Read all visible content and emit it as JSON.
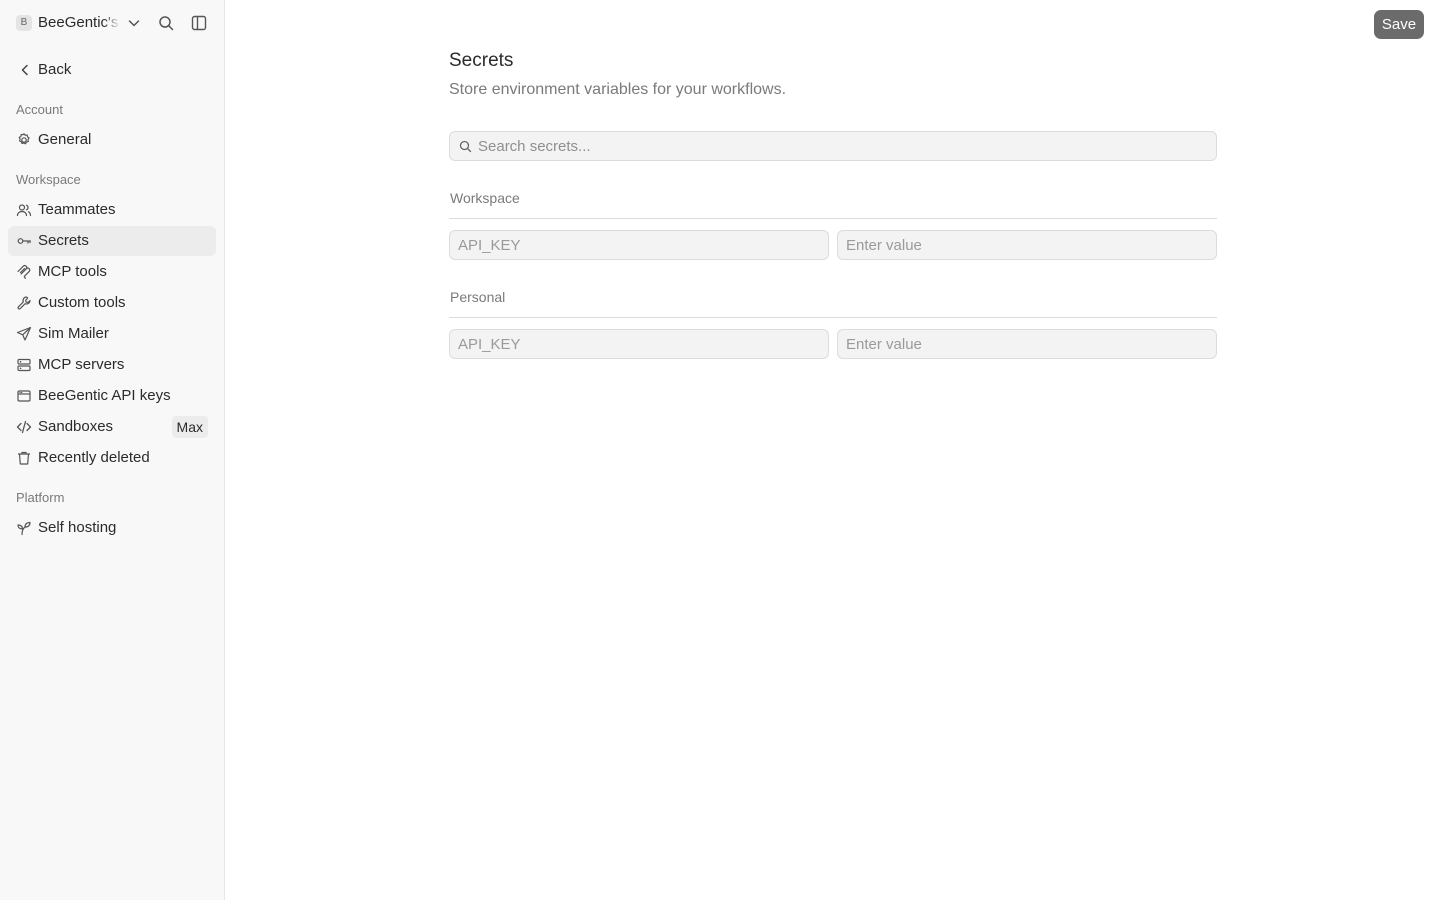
{
  "workspace": {
    "avatar_letter": "B",
    "name": "BeeGentic's"
  },
  "sidebar": {
    "back_label": "Back",
    "sections": [
      {
        "label": "Account",
        "items": [
          {
            "label": "General",
            "icon": "gear-icon",
            "active": false
          }
        ]
      },
      {
        "label": "Workspace",
        "items": [
          {
            "label": "Teammates",
            "icon": "users-icon",
            "active": false
          },
          {
            "label": "Secrets",
            "icon": "key-icon",
            "active": true
          },
          {
            "label": "MCP tools",
            "icon": "mcp-icon",
            "active": false
          },
          {
            "label": "Custom tools",
            "icon": "wrench-icon",
            "active": false
          },
          {
            "label": "Sim Mailer",
            "icon": "send-icon",
            "active": false
          },
          {
            "label": "MCP servers",
            "icon": "server-icon",
            "active": false
          },
          {
            "label": "BeeGentic API keys",
            "icon": "browser-window-icon",
            "active": false
          },
          {
            "label": "Sandboxes",
            "icon": "code-icon",
            "active": false,
            "badge": "Max"
          },
          {
            "label": "Recently deleted",
            "icon": "trash-icon",
            "active": false
          }
        ]
      },
      {
        "label": "Platform",
        "items": [
          {
            "label": "Self hosting",
            "icon": "sprout-icon",
            "active": false
          }
        ]
      }
    ]
  },
  "toolbar": {
    "save_label": "Save"
  },
  "main": {
    "title": "Secrets",
    "subtitle": "Store environment variables for your workflows.",
    "search": {
      "placeholder": "Search secrets...",
      "value": ""
    },
    "groups": [
      {
        "label": "Workspace",
        "key_placeholder": "API_KEY",
        "value_placeholder": "Enter value"
      },
      {
        "label": "Personal",
        "key_placeholder": "API_KEY",
        "value_placeholder": "Enter value"
      }
    ]
  },
  "colors": {
    "sidebar_bg": "#f8f8f8",
    "active_item_bg": "#ececec",
    "save_button_bg": "#6b6b6b",
    "input_bg": "#f3f3f3"
  }
}
